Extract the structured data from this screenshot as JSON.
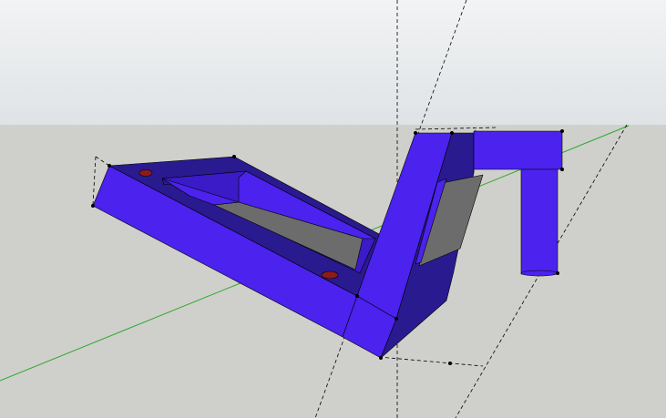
{
  "viewport": {
    "name": "3d-modeling-viewport",
    "sky_top_color": "#f2f3f4",
    "sky_bottom_color": "#dfe3e6",
    "ground_color": "#cfd0cb"
  },
  "model": {
    "face_color_light": "#4b22ee",
    "face_color_mid": "#3a1bc7",
    "face_color_dark": "#2a1a8f",
    "screen_color": "#6c6c6c",
    "hole_color": "#8f1a1a",
    "edge_color": "#000000"
  },
  "axes": {
    "green_axis_color": "#2ea82e",
    "dashed_axis_color": "#000000"
  }
}
